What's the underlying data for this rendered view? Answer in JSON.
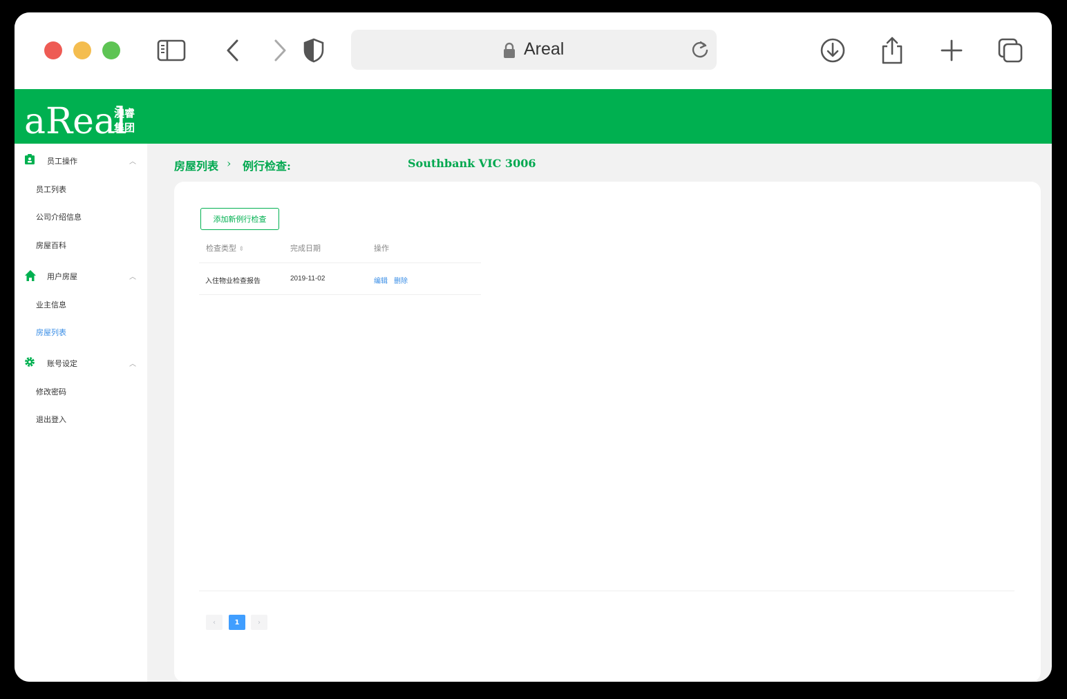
{
  "browser": {
    "address_text": "Areal",
    "icons": [
      "sidebar-toggle-icon",
      "back-icon",
      "forward-icon",
      "shield-icon",
      "lock-icon",
      "reload-icon",
      "download-icon",
      "share-icon",
      "new-tab-icon",
      "tabs-overview-icon"
    ]
  },
  "header": {
    "logo_text": "aReal",
    "logo_cn_line1": "澳睿",
    "logo_cn_line2": "集团",
    "brand_color": "#00b050"
  },
  "sidebar": {
    "groups": [
      {
        "label": "员工操作",
        "icon": "id-badge-icon",
        "items": [
          "员工列表",
          "公司介绍信息",
          "房屋百科"
        ]
      },
      {
        "label": "用户房屋",
        "icon": "home-icon",
        "items": [
          "业主信息",
          "房屋列表"
        ]
      },
      {
        "label": "账号设定",
        "icon": "gear-icon",
        "items": [
          "修改密码",
          "退出登入"
        ]
      }
    ],
    "active_item": "房屋列表"
  },
  "breadcrumb": {
    "item1": "房屋列表",
    "separator": "›",
    "item2": "例行检查:",
    "address": "Southbank VIC 3006"
  },
  "main": {
    "add_button": "添加新例行检查",
    "table": {
      "headers": [
        "检查类型",
        "完成日期",
        "操作"
      ],
      "rows": [
        {
          "type": "入住物业检查报告",
          "date": "2019-11-02",
          "edit": "编辑",
          "delete": "删除"
        }
      ]
    },
    "pagination": {
      "prev": "‹",
      "current": "1",
      "next": "›"
    }
  }
}
